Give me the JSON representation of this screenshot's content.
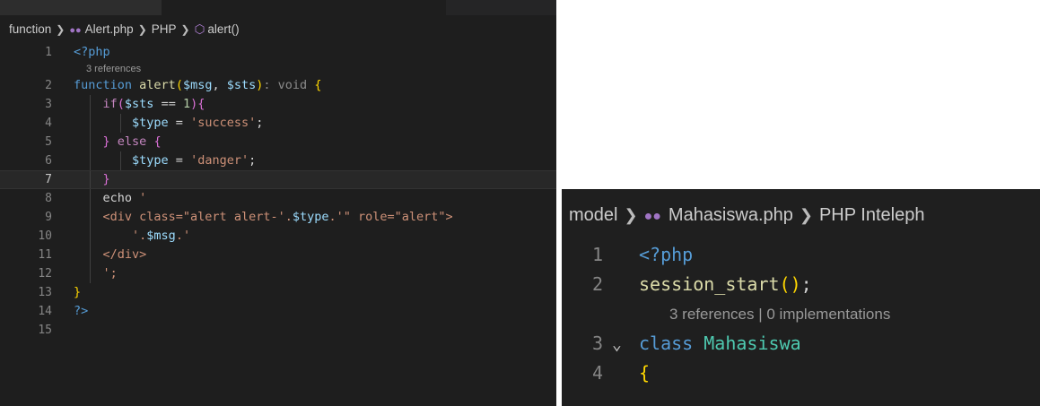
{
  "left_editor": {
    "breadcrumb": {
      "folder": "function",
      "file": "Alert.php",
      "language": "PHP",
      "symbol": "alert()"
    },
    "codelens": "3 references",
    "lines": [
      {
        "n": "1"
      },
      {
        "n": "2"
      },
      {
        "n": "3"
      },
      {
        "n": "4"
      },
      {
        "n": "5"
      },
      {
        "n": "6"
      },
      {
        "n": "7"
      },
      {
        "n": "8"
      },
      {
        "n": "9"
      },
      {
        "n": "10"
      },
      {
        "n": "11"
      },
      {
        "n": "12"
      },
      {
        "n": "13"
      },
      {
        "n": "14"
      },
      {
        "n": "15"
      }
    ],
    "tokens": {
      "php_open": "<?php",
      "function_kw": "function",
      "fn_name": "alert",
      "p1": "$msg",
      "comma": ", ",
      "p2": "$sts",
      "ret_hint": ": void",
      "if_kw": "if",
      "sts": "$sts",
      "eq": " == ",
      "one": "1",
      "type_var": "$type",
      "assign": " = ",
      "success": "'success'",
      "else_kw": "else",
      "danger": "'danger'",
      "echo_kw": "echo",
      "quote_open": "'",
      "html_line": "<div class=\"alert alert-'.",
      "html_type": "$type",
      "html_line_end": ".'\" role=\"alert\">",
      "msg_pre": "'.",
      "msg_var": "$msg",
      "msg_post": ".'",
      "div_close": "</div>",
      "end_str": "';",
      "php_close": "?>"
    }
  },
  "right_editor": {
    "breadcrumb": {
      "folder": "model",
      "file": "Mahasiswa.php",
      "context": "PHP Inteleph"
    },
    "codelens": "3 references | 0 implementations",
    "lines": [
      {
        "n": "1",
        "code": "<?php"
      },
      {
        "n": "2",
        "fn": "session_start",
        "tail": ";"
      },
      {
        "n": "3",
        "kw": "class",
        "cls": "Mahasiswa"
      },
      {
        "n": "4",
        "brace": "{"
      }
    ],
    "fold_icon": "chevron-down-icon"
  }
}
